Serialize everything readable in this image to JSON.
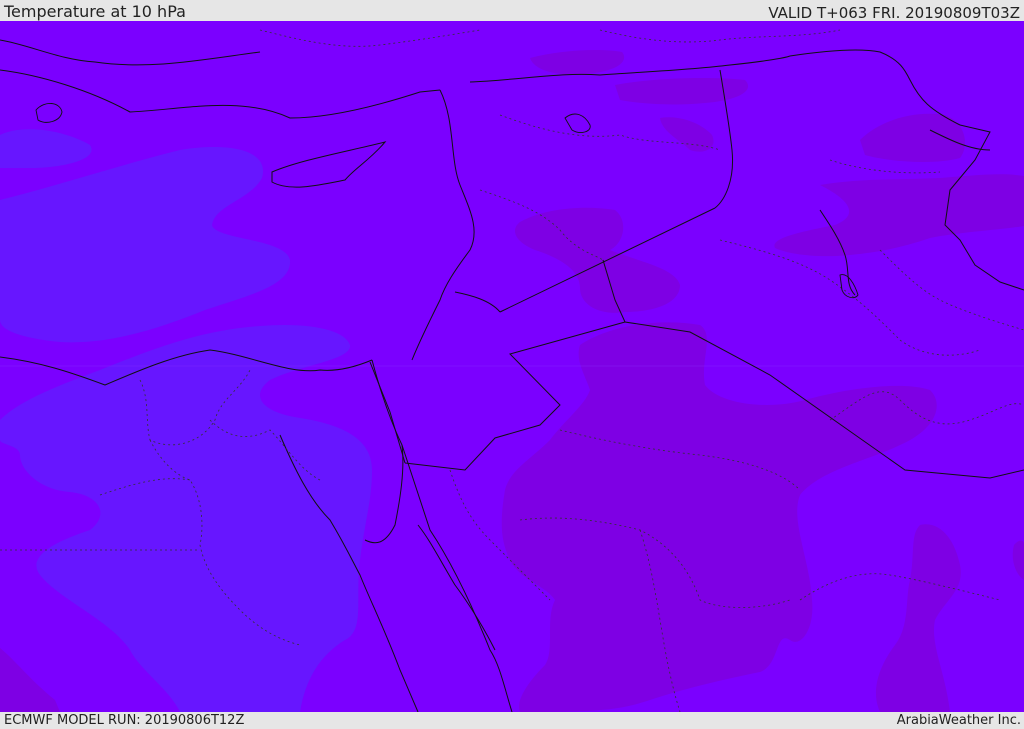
{
  "header": {
    "title": "Temperature at 10 hPa",
    "valid_time": "VALID T+063 FRI. 20190809T03Z"
  },
  "footer": {
    "model_run": "ECMWF MODEL RUN: 20190806T12Z",
    "credit": "ArabiaWeather Inc."
  },
  "colors": {
    "background_field": "#7b00ff",
    "colder_field": "#6716ff",
    "warmer_field": "#7e00e4",
    "coastline": "#111111",
    "border_dotted": "#333333"
  }
}
